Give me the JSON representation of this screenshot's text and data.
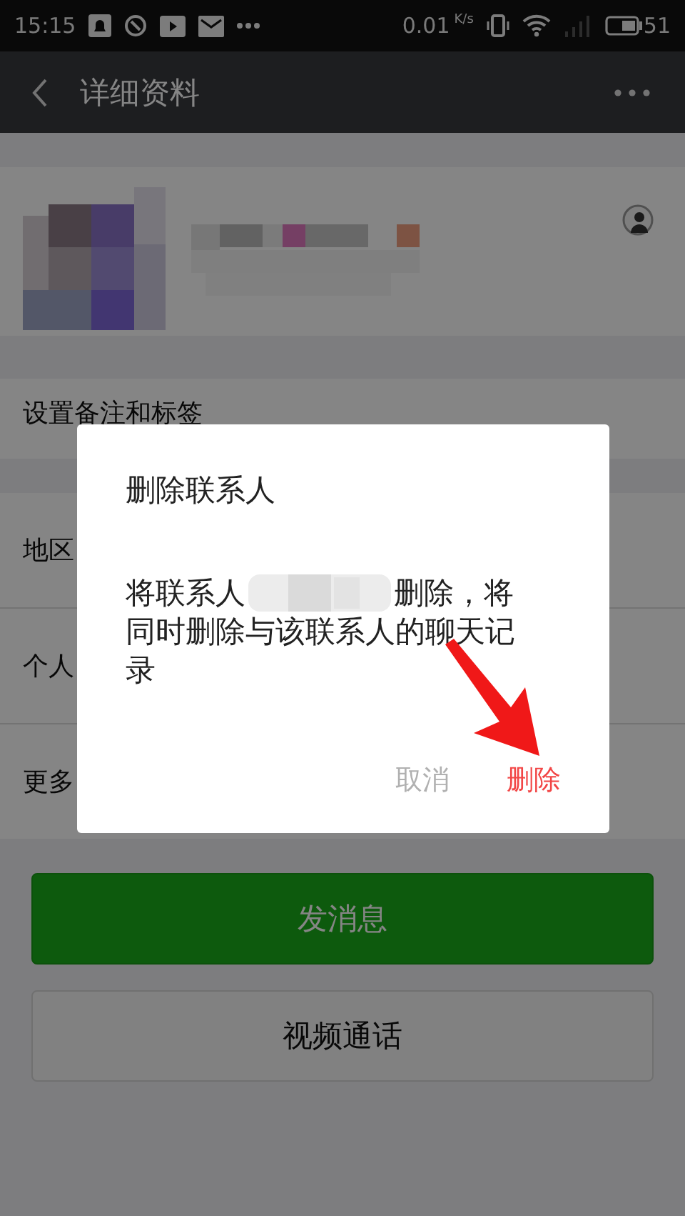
{
  "status_bar": {
    "time": "15:15",
    "net_speed": "0.01",
    "net_speed_unit": "K/s",
    "battery": "51"
  },
  "header": {
    "title": "详细资料"
  },
  "sections": [
    {
      "rows": [
        {
          "label": "设置备注和标签"
        }
      ]
    },
    {
      "rows": [
        {
          "label": "地区"
        },
        {
          "label": "个人"
        },
        {
          "label": "更多"
        }
      ]
    }
  ],
  "buttons": [
    {
      "label": "发消息",
      "kind": "primary"
    },
    {
      "label": "视频通话",
      "kind": "secondary"
    }
  ],
  "dialog": {
    "title": "删除联系人",
    "message_lead": "将联系人",
    "message_line_end": "删除，将",
    "message_rest": "同时删除与该联系人的聊天记录",
    "actions": [
      {
        "label": "取消",
        "kind": "cancel"
      },
      {
        "label": "删除",
        "kind": "confirm"
      }
    ]
  }
}
